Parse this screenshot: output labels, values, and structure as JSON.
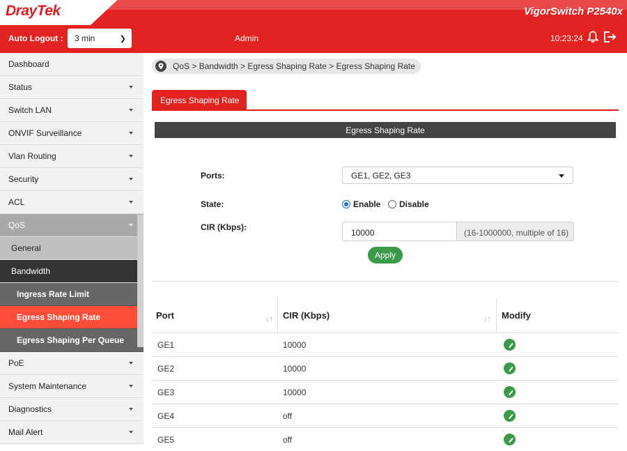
{
  "brand": {
    "logo": "DrayTek",
    "model": "VigorSwitch P2540x",
    "accent": "#e32322"
  },
  "header": {
    "auto_logout_label": "Auto Logout :",
    "auto_logout_value": "3 min",
    "user": "Admin",
    "time": "10:23:24"
  },
  "sidebar": {
    "items": [
      {
        "label": "Dashboard"
      },
      {
        "label": "Status"
      },
      {
        "label": "Switch LAN"
      },
      {
        "label": "ONVIF Surveillance"
      },
      {
        "label": "Vlan Routing"
      },
      {
        "label": "Security"
      },
      {
        "label": "ACL"
      },
      {
        "label": "QoS"
      },
      {
        "label": "General"
      },
      {
        "label": "Bandwidth"
      },
      {
        "label": "Ingress Rate Limit"
      },
      {
        "label": "Egress Shaping Rate"
      },
      {
        "label": "Egress Shaping Per Queue"
      },
      {
        "label": "PoE"
      },
      {
        "label": "System Maintenance"
      },
      {
        "label": "Diagnostics"
      },
      {
        "label": "Mail Alert"
      }
    ]
  },
  "breadcrumb": "QoS > Bandwidth > Egress Shaping Rate  > Egress Shaping Rate",
  "tab_label": "Egress Shaping Rate",
  "form": {
    "section_title": "Egress Shaping Rate",
    "ports_label": "Ports:",
    "ports_value": "GE1, GE2, GE3",
    "state_label": "State:",
    "enable_label": "Enable",
    "disable_label": "Disable",
    "cir_label": "CIR (Kbps):",
    "cir_value": "10000",
    "cir_hint": "(16-1000000, multiple of 16)",
    "apply_label": "Apply"
  },
  "table": {
    "headers": [
      "Port",
      "CIR (Kbps)",
      "Modify"
    ],
    "rows": [
      {
        "port": "GE1",
        "cir": "10000"
      },
      {
        "port": "GE2",
        "cir": "10000"
      },
      {
        "port": "GE3",
        "cir": "10000"
      },
      {
        "port": "GE4",
        "cir": "off"
      },
      {
        "port": "GE5",
        "cir": "off"
      }
    ]
  }
}
